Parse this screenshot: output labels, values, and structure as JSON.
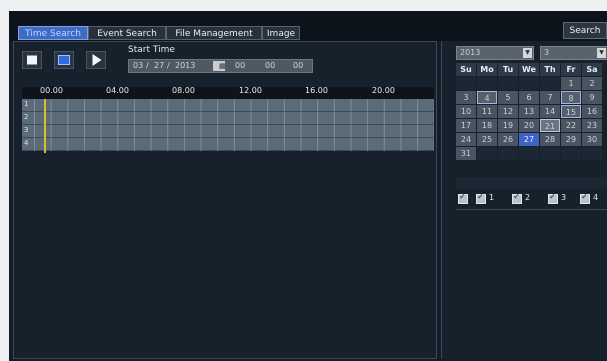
{
  "tabs": [
    {
      "label": "Time Search",
      "active": true
    },
    {
      "label": "Event Search",
      "active": false
    },
    {
      "label": "File Management",
      "active": false
    },
    {
      "label": "Image",
      "active": false
    }
  ],
  "search_button": "Search",
  "playback": {
    "start_time_label": "Start Time",
    "date": {
      "month": "03",
      "sep1": "/",
      "day": "27",
      "sep2": "/",
      "year": "2013"
    },
    "time": {
      "hour": "00",
      "minute": "00",
      "second": "00"
    },
    "controls": [
      "stop-icon",
      "split-screen-icon",
      "play-icon"
    ]
  },
  "timeline": {
    "ticks": [
      "00.00",
      "04.00",
      "08.00",
      "12.00",
      "16.00",
      "20.00"
    ],
    "tracks": [
      "1",
      "2",
      "3",
      "4"
    ]
  },
  "calendar": {
    "year": "2013",
    "month": "3",
    "weekdays": [
      "Su",
      "Mo",
      "Tu",
      "We",
      "Th",
      "Fr",
      "Sa"
    ],
    "rows": [
      [
        "",
        "",
        "",
        "",
        "",
        "1",
        "2"
      ],
      [
        "3",
        "4",
        "5",
        "6",
        "7",
        "8",
        "9"
      ],
      [
        "10",
        "11",
        "12",
        "13",
        "14",
        "15",
        "16"
      ],
      [
        "17",
        "18",
        "19",
        "20",
        "21",
        "22",
        "23"
      ],
      [
        "24",
        "25",
        "26",
        "27",
        "28",
        "29",
        "30"
      ],
      [
        "31",
        "",
        "",
        "",
        "",
        "",
        ""
      ]
    ],
    "marked_days": [
      "4",
      "8",
      "15"
    ],
    "today": "21",
    "selected_day": "27"
  },
  "channels": [
    "1",
    "2",
    "3",
    "4"
  ],
  "colors": {
    "active_tab": "#3d6bc6",
    "selected_day": "#3b64c4",
    "timeline_cursor": "#d4c12b",
    "background": "#141d27"
  }
}
